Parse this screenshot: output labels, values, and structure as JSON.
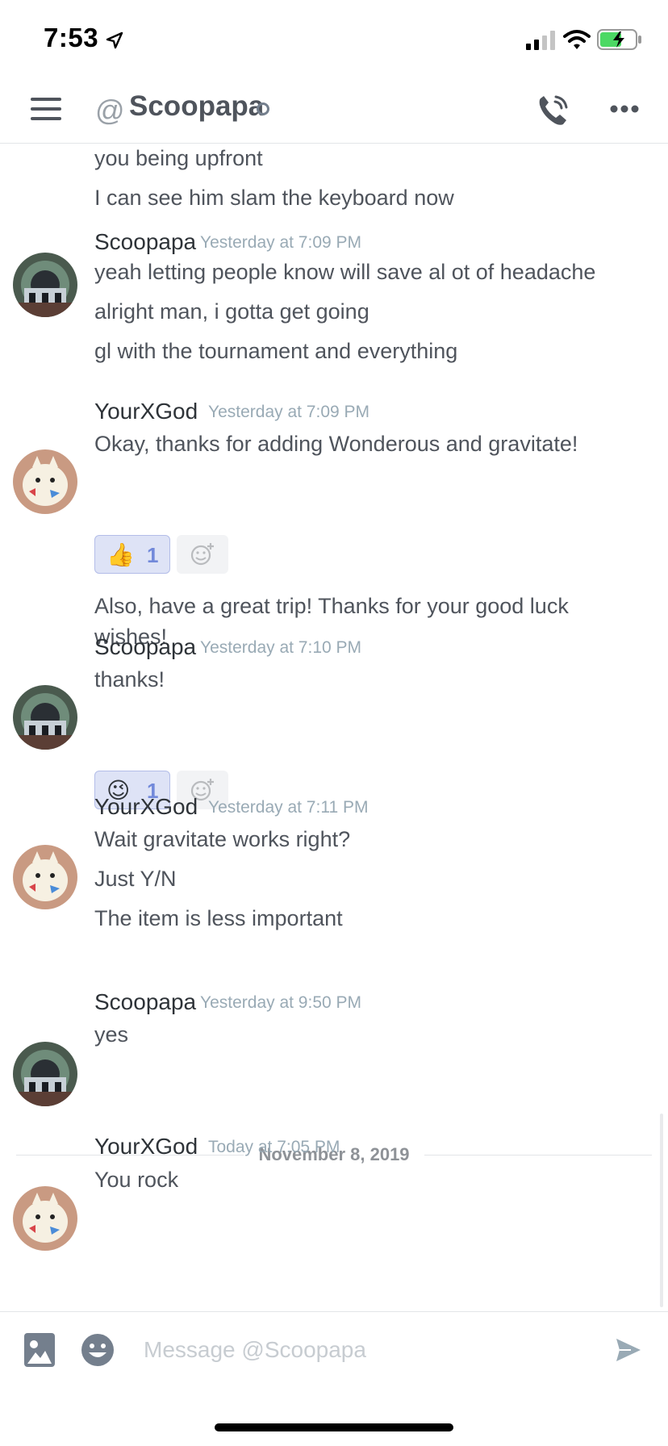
{
  "status_bar": {
    "time": "7:53"
  },
  "header": {
    "at_symbol": "@",
    "channel_name": "Scoopapa"
  },
  "messages": {
    "continued_lines": [
      "you being upfront",
      "I can see him slam the keyboard now"
    ],
    "groups": [
      {
        "author": "Scoopapa",
        "timestamp": "Yesterday at 7:09 PM",
        "lines": [
          "yeah letting people know will save al ot of headache",
          "alright man, i gotta get going",
          "gl with the tournament and everything"
        ]
      },
      {
        "author": "YourXGod",
        "timestamp": "Yesterday at 7:09 PM",
        "lines": [
          "Okay, thanks for adding Wonderous and gravitate!",
          "Also, have a great trip! Thanks for your good luck wishes!"
        ],
        "reaction": {
          "emoji": "👍",
          "count": "1"
        }
      },
      {
        "author": "Scoopapa",
        "timestamp": "Yesterday at 7:10 PM",
        "lines": [
          "thanks!"
        ],
        "reaction": {
          "emoji": "😉",
          "count": "1"
        }
      },
      {
        "author": "YourXGod",
        "timestamp": "Yesterday at 7:11 PM",
        "lines": [
          "Wait gravitate works right?",
          "Just Y/N",
          "The item is less important"
        ]
      },
      {
        "author": "Scoopapa",
        "timestamp": "Yesterday at 9:50 PM",
        "lines": [
          "yes"
        ]
      },
      {
        "author": "YourXGod",
        "timestamp": "Today at 7:05 PM",
        "lines": [
          "You rock"
        ]
      }
    ],
    "date_divider": "November 8, 2019"
  },
  "composer": {
    "placeholder": "Message @Scoopapa"
  },
  "colors": {
    "accent": "#7289da",
    "reaction_bg": "#dee3f6",
    "timestamp": "#99aab5"
  }
}
